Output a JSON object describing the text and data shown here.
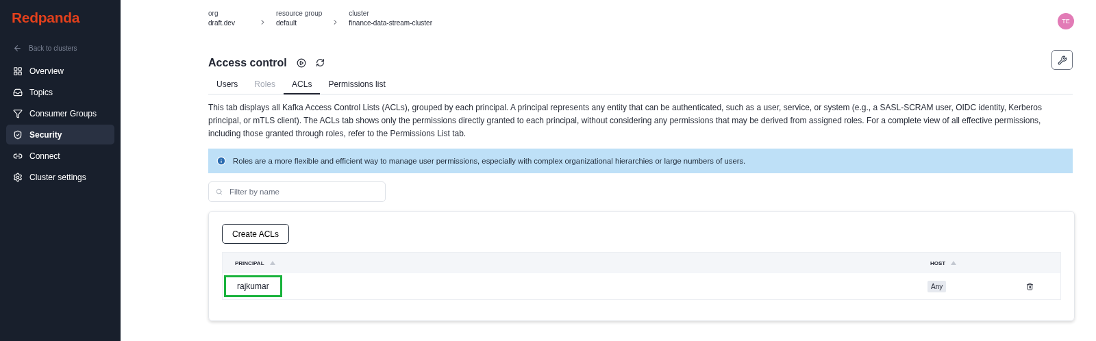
{
  "sidebar": {
    "logo": "Redpanda",
    "back_link": "Back to clusters",
    "items": [
      {
        "label": "Overview",
        "selected": false
      },
      {
        "label": "Topics",
        "selected": false
      },
      {
        "label": "Consumer Groups",
        "selected": false
      },
      {
        "label": "Security",
        "selected": true
      },
      {
        "label": "Connect",
        "selected": false
      },
      {
        "label": "Cluster settings",
        "selected": false
      }
    ]
  },
  "breadcrumb": [
    {
      "label": "org",
      "value": "draft.dev"
    },
    {
      "label": "resource group",
      "value": "default"
    },
    {
      "label": "cluster",
      "value": "finance-data-stream-cluster"
    }
  ],
  "avatar": "TE",
  "page_title": "Access control",
  "tabs": [
    {
      "label": "Users",
      "selected": false,
      "disabled": false
    },
    {
      "label": "Roles",
      "selected": false,
      "disabled": true
    },
    {
      "label": "ACLs",
      "selected": true,
      "disabled": false
    },
    {
      "label": "Permissions list",
      "selected": false,
      "disabled": false
    }
  ],
  "description": "This tab displays all Kafka Access Control Lists (ACLs), grouped by each principal. A principal represents any entity that can be authenticated, such as a user, service, or system (e.g., a SASL-SCRAM user, OIDC identity, Kerberos principal, or mTLS client). The ACLs tab shows only the permissions directly granted to each principal, without considering any permissions that may be derived from assigned roles. For a complete view of all effective permissions, including those granted through roles, refer to the Permissions List tab.",
  "info_alert": "Roles are a more flexible and efficient way to manage user permissions, especially with complex organizational hierarchies or large numbers of users.",
  "filter": {
    "placeholder": "Filter by name"
  },
  "create_button": "Create ACLs",
  "table": {
    "columns": [
      "PRINCIPAL",
      "HOST"
    ],
    "rows": [
      {
        "principal": "rajkumar",
        "host": "Any",
        "highlighted": true
      }
    ]
  }
}
